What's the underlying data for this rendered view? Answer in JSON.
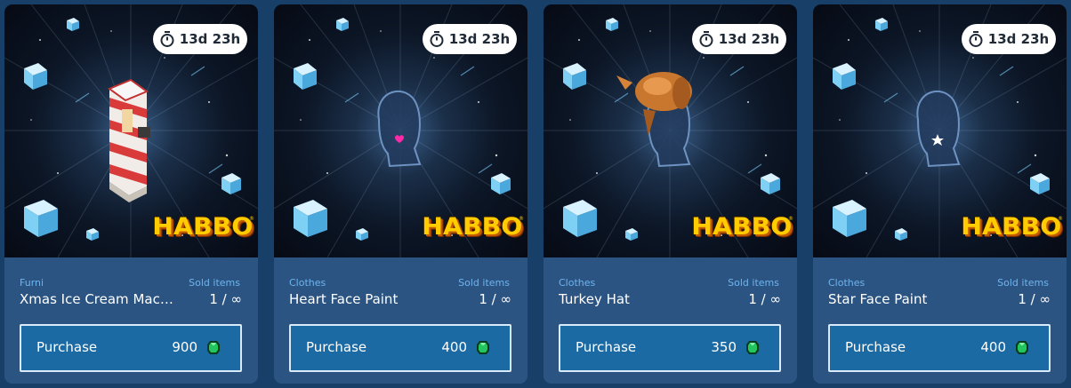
{
  "cards": [
    {
      "category": "Furni",
      "name": "Xmas Ice Cream Mac…",
      "timer": "13d 23h",
      "sold_label": "Sold items",
      "sold_value": "1 / ∞",
      "purchase_label": "Purchase",
      "price": "900",
      "item_icon": "ice-cream-machine-icon"
    },
    {
      "category": "Clothes",
      "name": "Heart Face Paint",
      "timer": "13d 23h",
      "sold_label": "Sold items",
      "sold_value": "1 / ∞",
      "purchase_label": "Purchase",
      "price": "400",
      "item_icon": "heart-face-paint-icon"
    },
    {
      "category": "Clothes",
      "name": "Turkey Hat",
      "timer": "13d 23h",
      "sold_label": "Sold items",
      "sold_value": "1 / ∞",
      "purchase_label": "Purchase",
      "price": "350",
      "item_icon": "turkey-hat-icon"
    },
    {
      "category": "Clothes",
      "name": "Star Face Paint",
      "timer": "13d 23h",
      "sold_label": "Sold items",
      "sold_value": "1 / ∞",
      "purchase_label": "Purchase",
      "price": "400",
      "item_icon": "star-face-paint-icon"
    }
  ],
  "brand": {
    "logo_text": "HABBO",
    "trademark": "®"
  },
  "colors": {
    "page_background": "#183f68",
    "card_background": "#2b5482",
    "button_background": "#1c6aa3",
    "button_border": "#d9ebfb",
    "label_blue": "#6fb4ef",
    "currency_green": "#22c55e",
    "logo_yellow": "#ffcc00"
  },
  "icons": {
    "timer": "stopwatch-icon",
    "currency": "emerald-gem-icon"
  }
}
